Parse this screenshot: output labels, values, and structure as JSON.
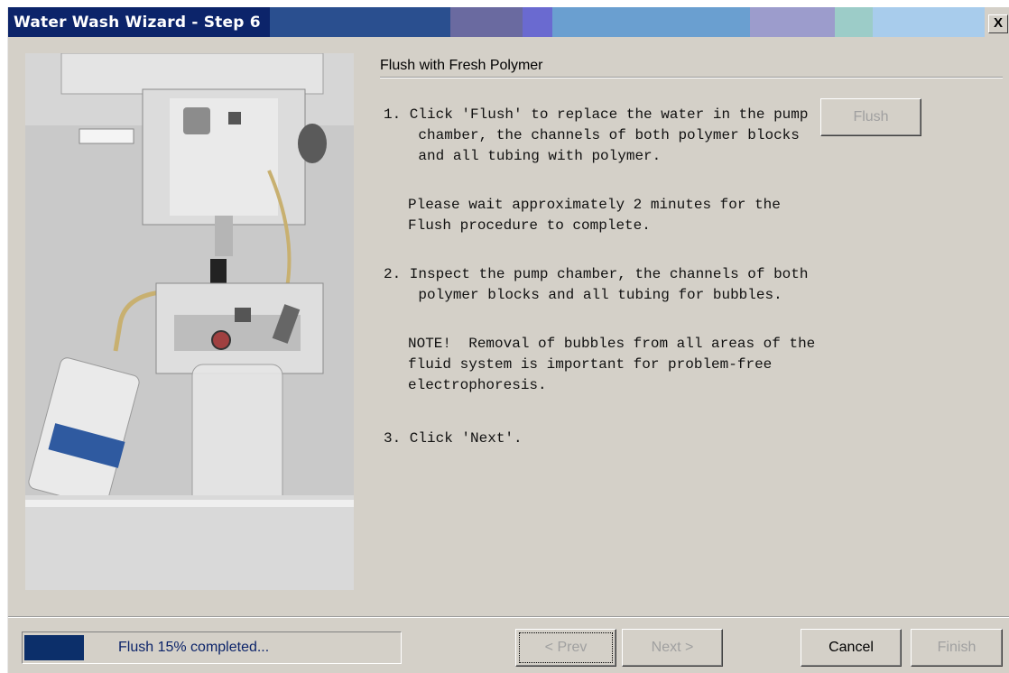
{
  "window": {
    "title": "Water Wash Wizard - Step 6",
    "close_label": "X"
  },
  "content": {
    "heading": "Flush with Fresh Polymer",
    "step1": "1. Click 'Flush' to replace the water in the pump\n    chamber, the channels of both polymer blocks\n    and all tubing with polymer.",
    "step1_wait": "Please wait approximately 2 minutes for the\nFlush procedure to complete.",
    "step2": "2. Inspect the pump chamber, the channels of both\n    polymer blocks and all tubing for bubbles.",
    "note": "NOTE!  Removal of bubbles from all areas of the\nfluid system is important for problem-free\nelectrophoresis.",
    "step3": "3. Click 'Next'.",
    "flush_button": "Flush"
  },
  "status": {
    "text": "Flush   15% completed...",
    "progress_percent": 15,
    "fill_color": "#0c2f6a"
  },
  "footer": {
    "prev_label": "< Prev",
    "next_label": "Next >",
    "cancel_label": "Cancel",
    "finish_label": "Finish"
  },
  "colors": {
    "dialog_bg": "#d4d0c8",
    "title_text": "#ffffff",
    "disabled_text": "#a0a0a0"
  }
}
